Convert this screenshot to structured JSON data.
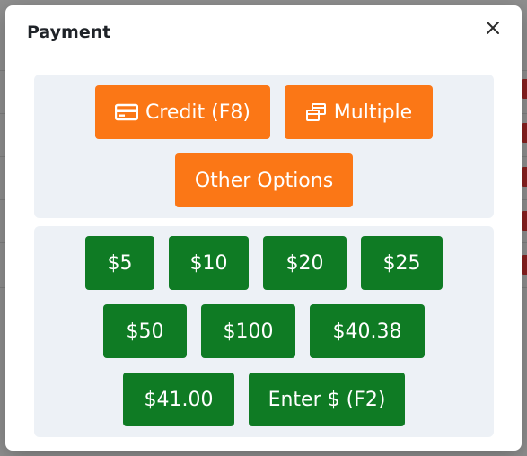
{
  "modal": {
    "title": "Payment",
    "close_icon": "close-icon"
  },
  "payment_methods": {
    "credit": {
      "label": "Credit (F8)",
      "icon": "credit-card-icon"
    },
    "multiple": {
      "label": "Multiple",
      "icon": "copy-windows-icon"
    },
    "other": {
      "label": "Other Options"
    }
  },
  "cash_amounts": {
    "row1": [
      "$5",
      "$10",
      "$20",
      "$25"
    ],
    "row2": [
      "$50",
      "$100",
      "$40.38"
    ],
    "row3": [
      "$41.00",
      "Enter $ (F2)"
    ]
  },
  "colors": {
    "orange": "#fb7716",
    "green": "#0f7b24",
    "panel": "#edf1f6"
  }
}
